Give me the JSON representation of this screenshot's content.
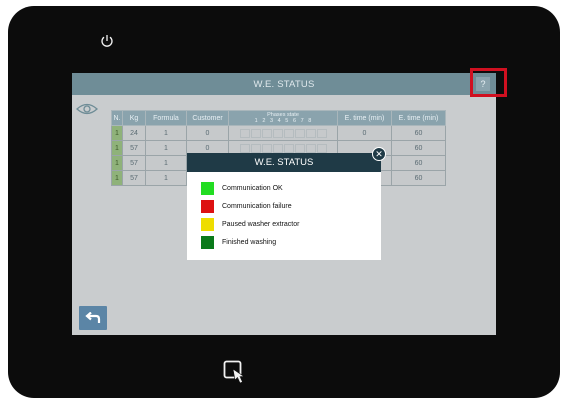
{
  "window": {
    "title": "W.E. STATUS",
    "help_label": "?"
  },
  "table": {
    "headers": [
      "N.",
      "Kg",
      "Formula",
      "Customer",
      "Phases state",
      "E. time (min)",
      "E. time (min)"
    ],
    "phase_numbers": [
      "1",
      "2",
      "3",
      "4",
      "5",
      "6",
      "7",
      "8"
    ],
    "rows": [
      {
        "n": "1",
        "kg": "24",
        "formula": "1",
        "customer": "0",
        "e_time": "0",
        "e_time_total": "60"
      },
      {
        "n": "1",
        "kg": "57",
        "formula": "1",
        "customer": "0",
        "e_time": "",
        "e_time_total": "60"
      },
      {
        "n": "1",
        "kg": "57",
        "formula": "1",
        "customer": "",
        "e_time": "",
        "e_time_total": "60"
      },
      {
        "n": "1",
        "kg": "57",
        "formula": "1",
        "customer": "",
        "e_time": "5",
        "e_time_total": "60"
      }
    ]
  },
  "modal": {
    "title": "W.E. STATUS",
    "legend": [
      {
        "label": "Communication OK",
        "color": "#22dd22"
      },
      {
        "label": "Communication failure",
        "color": "#dd1111"
      },
      {
        "label": "Paused washer extractor",
        "color": "#eedd00"
      },
      {
        "label": "Finished washing",
        "color": "#0a7a1a"
      }
    ]
  },
  "icons": {
    "power": "power-icon",
    "eye": "eye-icon",
    "back": "back-arrow-icon",
    "touch": "touch-hand-icon",
    "close": "close-icon"
  }
}
